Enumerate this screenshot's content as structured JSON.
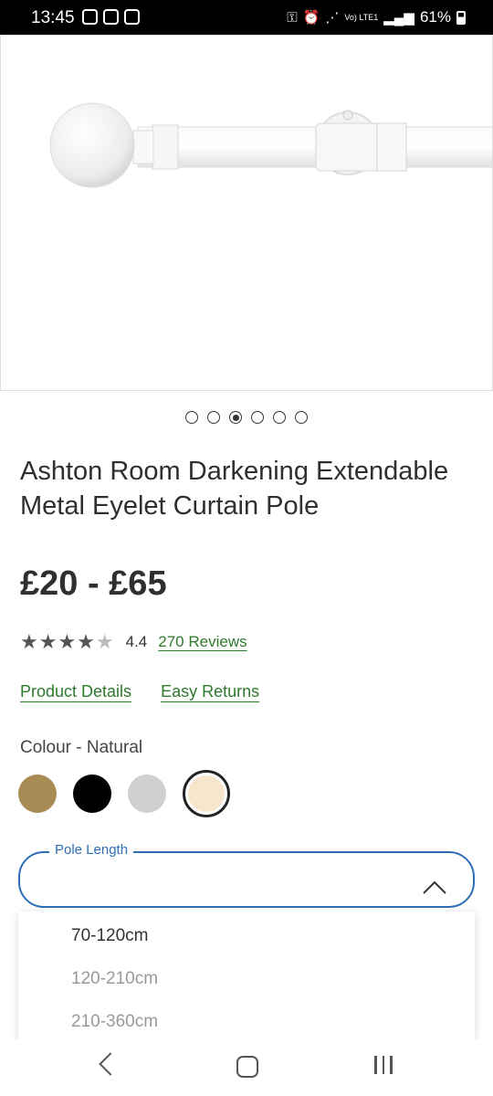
{
  "status_bar": {
    "time": "13:45",
    "network": "Vo) LTE1",
    "battery": "61%"
  },
  "carousel": {
    "count": 6,
    "active_index": 2
  },
  "product": {
    "title": "Ashton Room Darkening Extendable Metal Eyelet Curtain Pole",
    "price": "£20 - £65",
    "rating_value": "4.4",
    "rating_stars": 4.4,
    "reviews_label": "270 Reviews"
  },
  "links": {
    "details": "Product Details",
    "returns": "Easy Returns"
  },
  "colour": {
    "label": "Colour - Natural",
    "swatches": [
      {
        "name": "brass",
        "hex": "#a88a55"
      },
      {
        "name": "black",
        "hex": "#000000"
      },
      {
        "name": "silver",
        "hex": "#cfcfcf"
      },
      {
        "name": "natural",
        "hex": "#f7e6cc",
        "selected": true
      }
    ]
  },
  "pole_length": {
    "label": "Pole Length",
    "options": [
      "70-120cm",
      "120-210cm",
      "210-360cm"
    ]
  },
  "colors": {
    "link_green": "#2d7a2d",
    "select_blue": "#2d6fb7"
  }
}
